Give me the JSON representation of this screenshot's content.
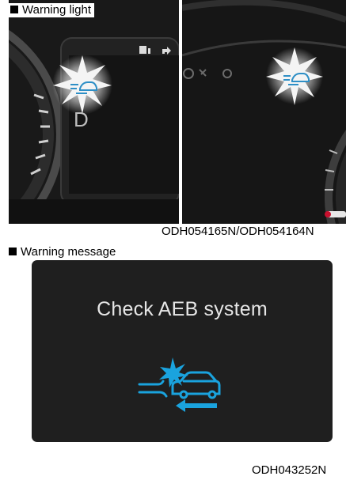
{
  "section_light": {
    "label": "Warning light"
  },
  "photo_caption": "ODH054165N/ODH054164N",
  "section_message": {
    "label": "Warning message",
    "message_text": "Check AEB system"
  },
  "bottom_caption": "ODH043252N",
  "colors": {
    "aeb_icon_blue": "#1aa3de",
    "screen_background": "#1f1f1f"
  },
  "icons": [
    "aeb-warning-icon",
    "fuel-range-icon",
    "turn-arrow-icon",
    "wrench-icon",
    "gear-icon"
  ]
}
